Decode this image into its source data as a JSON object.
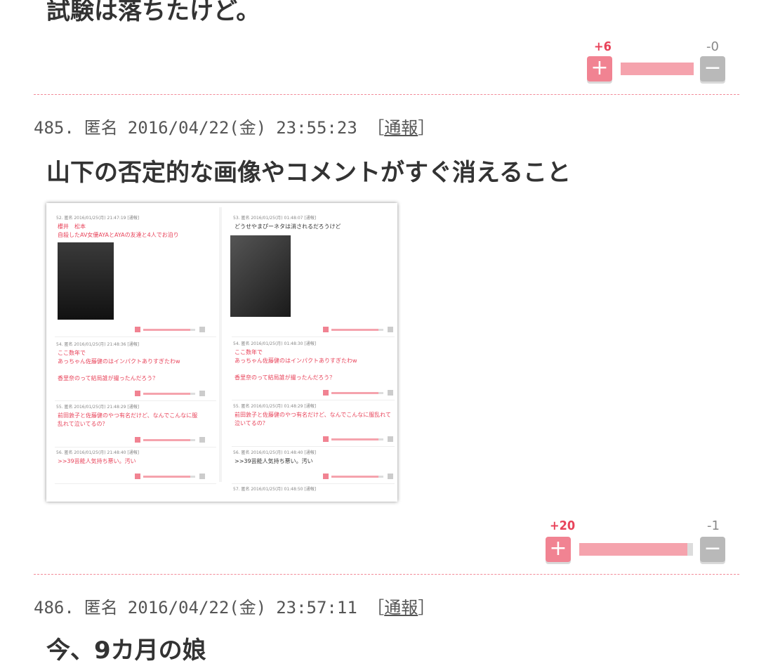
{
  "prev_comment": {
    "text": "試験は落ちたけど。",
    "plus_count": "+6",
    "minus_count": "-0",
    "plus_ratio": 1.0
  },
  "comment_485": {
    "number": "485.",
    "name": "匿名",
    "date": "2016/04/22(金)",
    "time": "23:55:23",
    "report_label": "通報",
    "text": "山下の否定的な画像やコメントがすぐ消えること",
    "plus_count": "+20",
    "minus_count": "-1",
    "plus_ratio": 0.95,
    "image": {
      "left": {
        "posts": [
          {
            "meta": "52. 匿名 2016/01/25(月) 21:47:19 [通報]",
            "lines": [
              "櫻井　松本",
              "自殺したAV女優AYAとAYAの友達と4人でお泊り"
            ]
          },
          {
            "meta": "54. 匿名 2016/01/25(月) 21:48:36 [通報]",
            "lines": [
              "ここ数年で",
              "あっちゃん佐藤健のはインパクトありすぎたわw",
              "",
              "香里奈のって結局誰が撮ったんだろう？"
            ]
          },
          {
            "meta": "55. 匿名 2016/01/25(月) 21:48:29 [通報]",
            "lines": [
              "前田敦子と佐藤健のやつ有名だけど、なんでこんなに服",
              "乱れて泣いてるの？"
            ]
          },
          {
            "meta": "56. 匿名 2016/01/25(月) 21:48:40 [通報]",
            "lines": [
              ">>39芸能人気持ち悪い。汚い"
            ]
          }
        ]
      },
      "right": {
        "posts": [
          {
            "meta": "53. 匿名 2016/01/25(月) 01:48:07 [通報]",
            "lines": [
              "どうせやまぴーネタは消されるだろうけど"
            ]
          },
          {
            "meta": "54. 匿名 2016/01/25(月) 01:48:30 [通報]",
            "lines": [
              "ここ数年で",
              "あっちゃん佐藤健のはインパクトありすぎたわw",
              "",
              "香里奈のって結局誰が撮ったんだろう？"
            ]
          },
          {
            "meta": "55. 匿名 2016/01/25(月) 01:48:29 [通報]",
            "lines": [
              "前田敦子と佐藤健のやつ有名だけど、なんでこんなに服乱れて",
              "泣いてるの？"
            ]
          },
          {
            "meta": "56. 匿名 2016/01/25(月) 01:48:40 [通報]",
            "lines": [
              ">>39芸能人気持ち悪い。汚い"
            ]
          },
          {
            "meta": "57. 匿名 2016/01/25(月) 01:48:50 [通報]",
            "lines": []
          }
        ]
      }
    }
  },
  "comment_486": {
    "number": "486.",
    "name": "匿名",
    "date": "2016/04/22(金)",
    "time": "23:57:11",
    "report_label": "通報",
    "text": "今、9カ月の娘"
  },
  "colors": {
    "accent": "#e8435a",
    "plus_button": "#f18392",
    "minus_button": "#b9b9b9",
    "divider": "#f28a98"
  },
  "icons": {
    "plus": "plus-icon",
    "minus": "minus-icon"
  }
}
